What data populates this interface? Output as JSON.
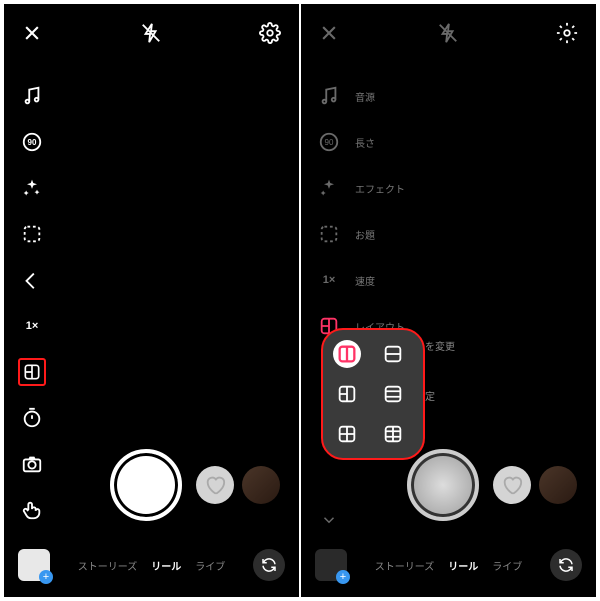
{
  "left": {
    "tools": [
      "music",
      "duration",
      "effects",
      "topic",
      "reply",
      "speed",
      "layout",
      "timer",
      "camera",
      "gesture"
    ],
    "duration_text": "90",
    "speed_text": "1×",
    "layout_highlighted": true,
    "modes": {
      "stories": "ストーリーズ",
      "reels": "リール",
      "live": "ライブ"
    },
    "active_mode": "reels"
  },
  "right": {
    "tool_labels": {
      "music": "音源",
      "duration": "長さ",
      "effects": "エフェクト",
      "topic": "お題",
      "speed": "速度",
      "layout": "レイアウト"
    },
    "duration_text": "90",
    "speed_text": "1×",
    "panel_text_change": "を変更",
    "panel_text_set": "定",
    "modes": {
      "stories": "ストーリーズ",
      "reels": "リール",
      "live": "ライブ"
    },
    "active_mode": "reels",
    "layout_options": [
      "split-v",
      "split-h",
      "grid-2x2-a",
      "grid-2x2-b",
      "grid-3",
      "grid-4"
    ]
  }
}
